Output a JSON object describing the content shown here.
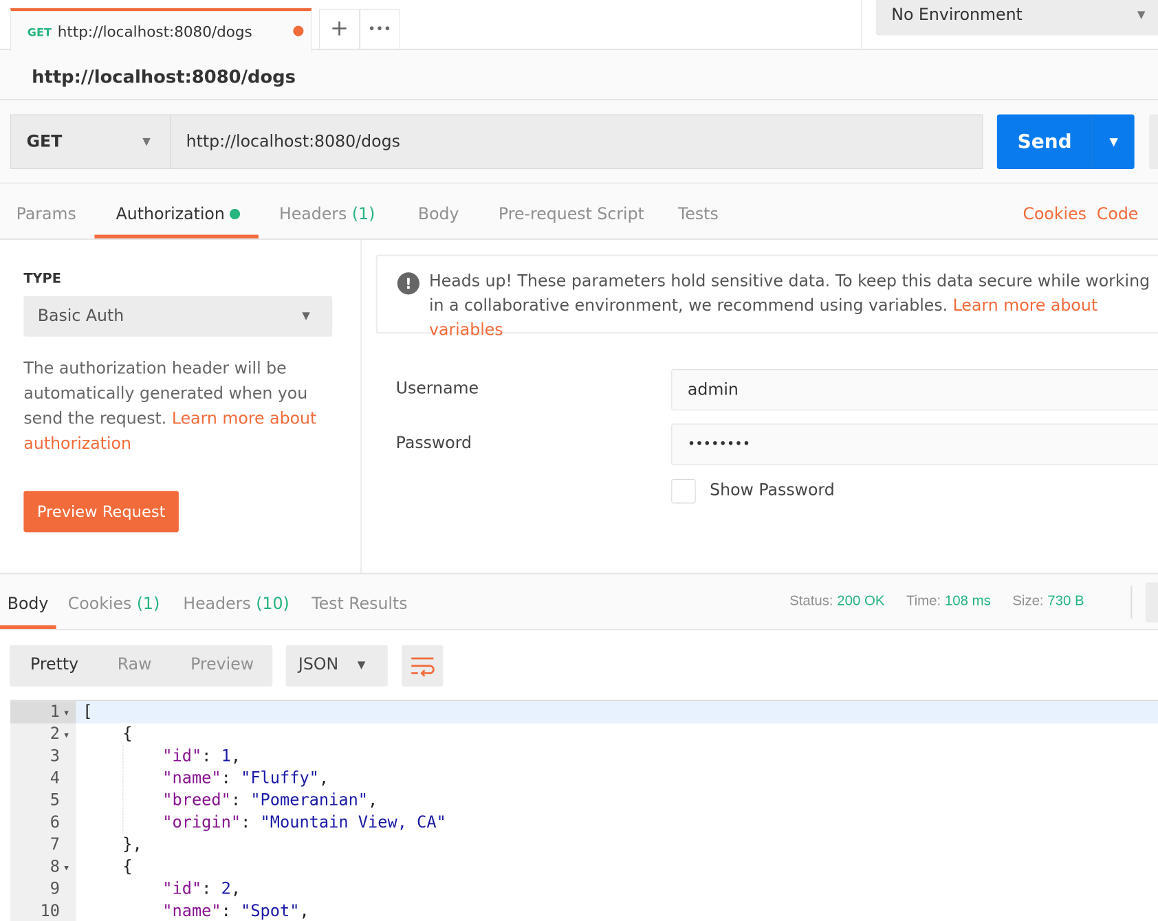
{
  "tab": {
    "method": "GET",
    "url": "http://localhost:8080/dogs",
    "new_tab": "+",
    "more": "•••"
  },
  "environment": {
    "selected": "No Environment"
  },
  "request": {
    "title": "http://localhost:8080/dogs",
    "method": "GET",
    "url": "http://localhost:8080/dogs",
    "send": "Send"
  },
  "req_tabs": [
    {
      "label": "Params"
    },
    {
      "label": "Authorization"
    },
    {
      "label": "Headers",
      "count": "(1)"
    },
    {
      "label": "Body"
    },
    {
      "label": "Pre-request Script"
    },
    {
      "label": "Tests"
    }
  ],
  "links": {
    "cookies": "Cookies",
    "code": "Code"
  },
  "auth": {
    "type_label": "TYPE",
    "type_value": "Basic Auth",
    "desc": "The authorization header will be automatically generated when you send the request.",
    "desc_link": "Learn more about authorization",
    "preview": "Preview Request",
    "notice": "Heads up! These parameters hold sensitive data. To keep this data secure while working in a collaborative environment, we recommend using variables.",
    "notice_link": "Learn more about variables",
    "username_label": "Username",
    "username": "admin",
    "password_label": "Password",
    "password": "••••••••",
    "show_password": "Show Password"
  },
  "resp_tabs": [
    {
      "label": "Body"
    },
    {
      "label": "Cookies",
      "count": "(1)"
    },
    {
      "label": "Headers",
      "count": "(10)"
    },
    {
      "label": "Test Results"
    }
  ],
  "status": {
    "status_label": "Status:",
    "status": "200 OK",
    "time_label": "Time:",
    "time": "108 ms",
    "size_label": "Size:",
    "size": "730 B"
  },
  "view": {
    "pretty": "Pretty",
    "raw": "Raw",
    "preview": "Preview",
    "format": "JSON"
  },
  "code_lines": [
    "1",
    "2",
    "3",
    "4",
    "5",
    "6",
    "7",
    "8",
    "9",
    "10"
  ],
  "json": {
    "l1": "[",
    "l2": "{",
    "l3k": "\"id\"",
    "l3v": "1",
    "l4k": "\"name\"",
    "l4v": "\"Fluffy\"",
    "l5k": "\"breed\"",
    "l5v": "\"Pomeranian\"",
    "l6k": "\"origin\"",
    "l6v": "\"Mountain View, CA\"",
    "l7": "},",
    "l8": "{",
    "l9k": "\"id\"",
    "l9v": "2",
    "l10k": "\"name\"",
    "l10v": "\"Spot\""
  },
  "colors": {
    "accent": "#f26b3a",
    "success": "#26b47f",
    "send": "#097bed"
  }
}
